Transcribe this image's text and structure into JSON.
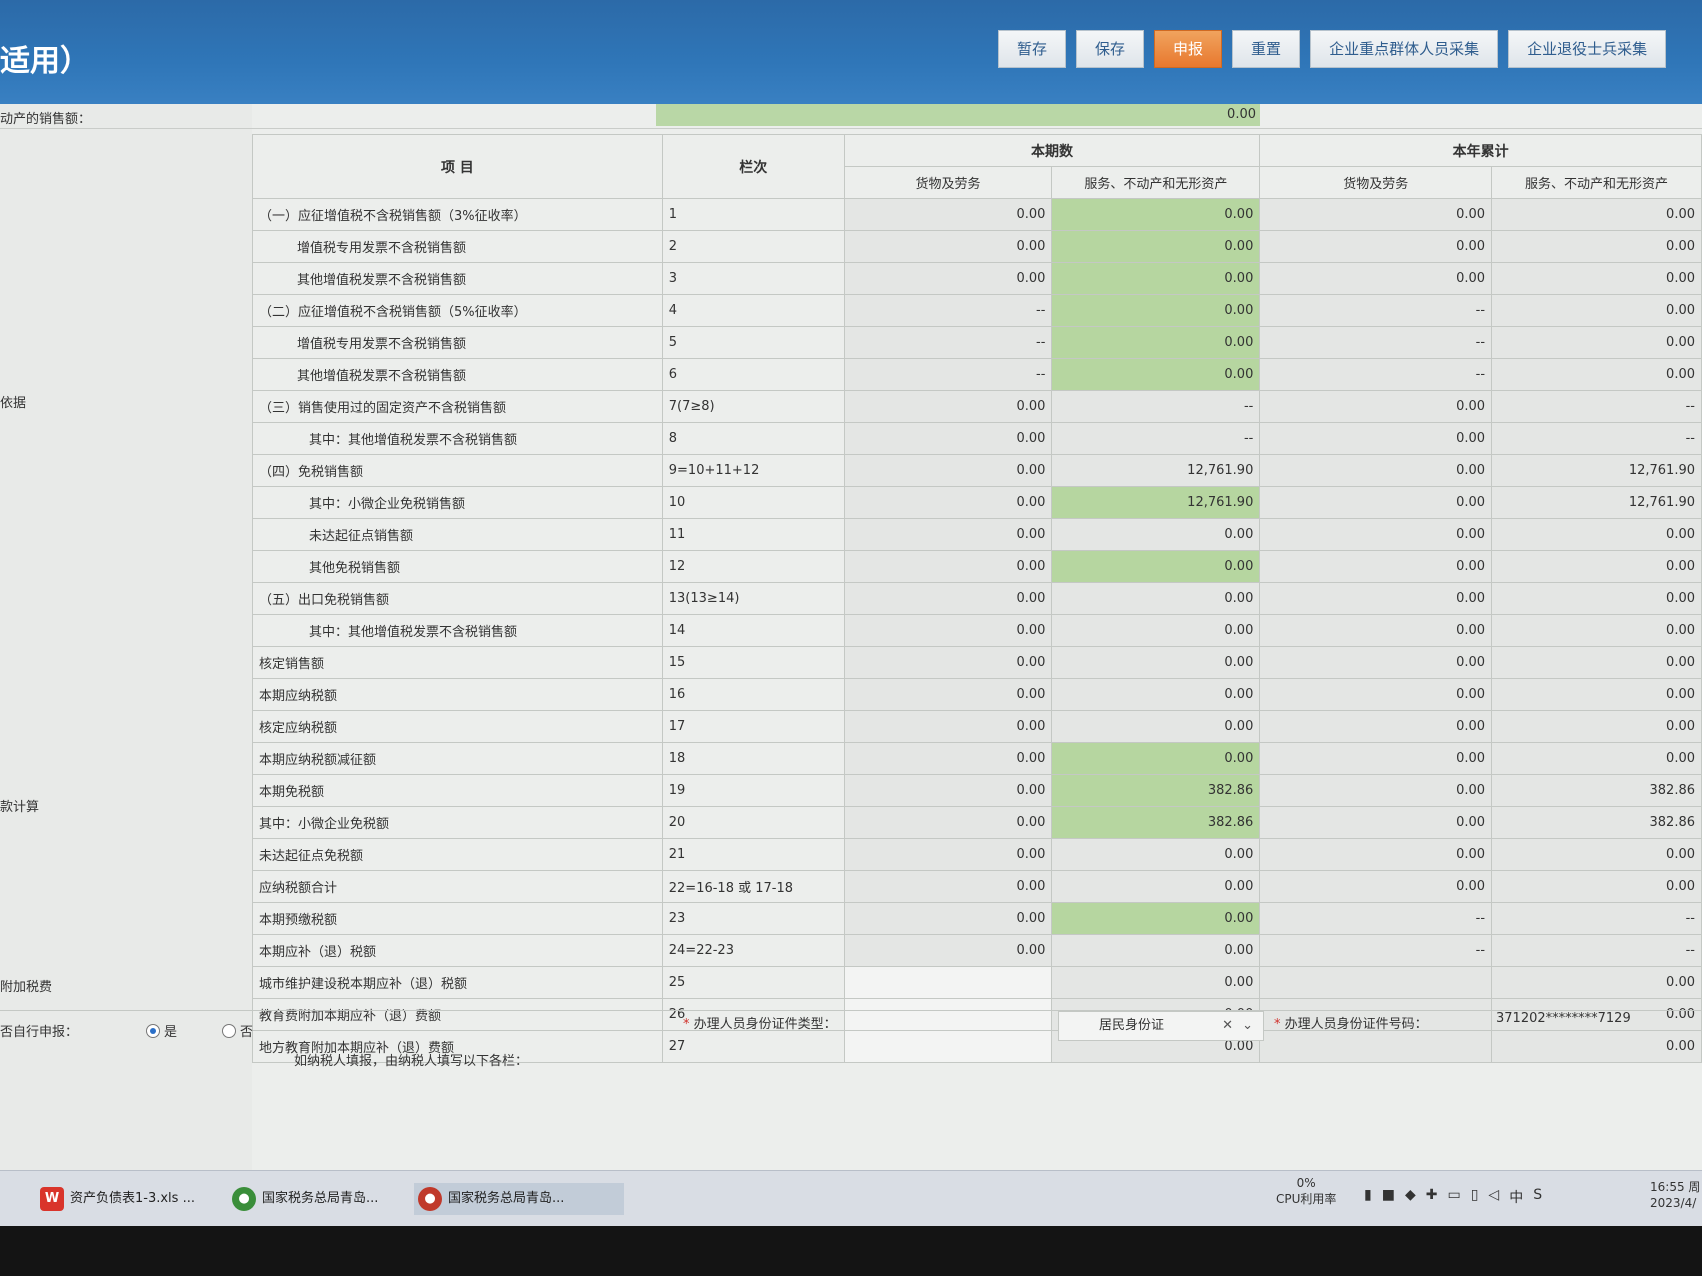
{
  "header": {
    "title": "适用）",
    "buttons": [
      "暂存",
      "保存",
      "申报",
      "重置",
      "企业重点群体人员采集",
      "企业退役士兵采集"
    ]
  },
  "sheet": {
    "top_label": "动产的销售额：",
    "top_value": "0.00",
    "side_labels": [
      "依据",
      "款计算",
      "附加税费"
    ],
    "headers": {
      "item": "项  目",
      "col": "栏次",
      "current": "本期数",
      "ytd": "本年累计",
      "goods": "货物及劳务",
      "services": "服务、不动产和无形资产"
    },
    "rows": [
      {
        "name": "（一）应征增值税不含税销售额（3%征收率）",
        "col": "1",
        "c1": "0.00",
        "c2": "0.00",
        "y1": "0.00",
        "y2": "0.00"
      },
      {
        "name": "增值税专用发票不含税销售额",
        "col": "2",
        "c1": "0.00",
        "c2": "0.00",
        "y1": "0.00",
        "y2": "0.00"
      },
      {
        "name": "其他增值税发票不含税销售额",
        "col": "3",
        "c1": "0.00",
        "c2": "0.00",
        "y1": "0.00",
        "y2": "0.00"
      },
      {
        "name": "（二）应征增值税不含税销售额（5%征收率）",
        "col": "4",
        "c1": "--",
        "c2": "0.00",
        "y1": "--",
        "y2": "0.00"
      },
      {
        "name": "增值税专用发票不含税销售额",
        "col": "5",
        "c1": "--",
        "c2": "0.00",
        "y1": "--",
        "y2": "0.00"
      },
      {
        "name": "其他增值税发票不含税销售额",
        "col": "6",
        "c1": "--",
        "c2": "0.00",
        "y1": "--",
        "y2": "0.00"
      },
      {
        "name": "（三）销售使用过的固定资产不含税销售额",
        "col": "7(7≥8)",
        "c1": "0.00",
        "c2": "--",
        "y1": "0.00",
        "y2": "--"
      },
      {
        "name": "其中：其他增值税发票不含税销售额",
        "col": "8",
        "c1": "0.00",
        "c2": "--",
        "y1": "0.00",
        "y2": "--"
      },
      {
        "name": "（四）免税销售额",
        "col": "9=10+11+12",
        "c1": "0.00",
        "c2": "12,761.90",
        "y1": "0.00",
        "y2": "12,761.90"
      },
      {
        "name": "其中：小微企业免税销售额",
        "col": "10",
        "c1": "0.00",
        "c2": "12,761.90",
        "y1": "0.00",
        "y2": "12,761.90"
      },
      {
        "name": "未达起征点销售额",
        "col": "11",
        "c1": "0.00",
        "c2": "0.00",
        "y1": "0.00",
        "y2": "0.00"
      },
      {
        "name": "其他免税销售额",
        "col": "12",
        "c1": "0.00",
        "c2": "0.00",
        "y1": "0.00",
        "y2": "0.00"
      },
      {
        "name": "（五）出口免税销售额",
        "col": "13(13≥14)",
        "c1": "0.00",
        "c2": "0.00",
        "y1": "0.00",
        "y2": "0.00"
      },
      {
        "name": "其中：其他增值税发票不含税销售额",
        "col": "14",
        "c1": "0.00",
        "c2": "0.00",
        "y1": "0.00",
        "y2": "0.00"
      },
      {
        "name": "核定销售额",
        "col": "15",
        "c1": "0.00",
        "c2": "0.00",
        "y1": "0.00",
        "y2": "0.00"
      },
      {
        "name": "本期应纳税额",
        "col": "16",
        "c1": "0.00",
        "c2": "0.00",
        "y1": "0.00",
        "y2": "0.00"
      },
      {
        "name": "核定应纳税额",
        "col": "17",
        "c1": "0.00",
        "c2": "0.00",
        "y1": "0.00",
        "y2": "0.00"
      },
      {
        "name": "本期应纳税额减征额",
        "col": "18",
        "c1": "0.00",
        "c2": "0.00",
        "y1": "0.00",
        "y2": "0.00"
      },
      {
        "name": "本期免税额",
        "col": "19",
        "c1": "0.00",
        "c2": "382.86",
        "y1": "0.00",
        "y2": "382.86"
      },
      {
        "name": "其中：小微企业免税额",
        "col": "20",
        "c1": "0.00",
        "c2": "382.86",
        "y1": "0.00",
        "y2": "382.86"
      },
      {
        "name": "未达起征点免税额",
        "col": "21",
        "c1": "0.00",
        "c2": "0.00",
        "y1": "0.00",
        "y2": "0.00"
      },
      {
        "name": "应纳税额合计",
        "col": "22=16-18 或 17-18",
        "c1": "0.00",
        "c2": "0.00",
        "y1": "0.00",
        "y2": "0.00"
      },
      {
        "name": "本期预缴税额",
        "col": "23",
        "c1": "0.00",
        "c2": "0.00",
        "y1": "--",
        "y2": "--"
      },
      {
        "name": "本期应补（退）税额",
        "col": "24=22-23",
        "c1": "0.00",
        "c2": "0.00",
        "y1": "--",
        "y2": "--"
      },
      {
        "name": "城市维护建设税本期应补（退）税额",
        "col": "25",
        "c1": "",
        "c2": "0.00",
        "y1": "",
        "y2": "0.00"
      },
      {
        "name": "教育费附加本期应补（退）费额",
        "col": "26",
        "c1": "",
        "c2": "0.00",
        "y1": "",
        "y2": "0.00"
      },
      {
        "name": "地方教育附加本期应补（退）费额",
        "col": "27",
        "c1": "",
        "c2": "0.00",
        "y1": "",
        "y2": "0.00"
      }
    ]
  },
  "footer": {
    "self_declare_label": "否自行申报：",
    "opt_yes": "是",
    "opt_no": "否",
    "id_type_label": "办理人员身份证件类型：",
    "id_type_value": "居民身份证",
    "id_no_label": "办理人员身份证件号码：",
    "id_no_value": "371202********7129",
    "note": "如纳税人填报，由纳税人填写以下各栏："
  },
  "taskbar": {
    "items": [
      "资产负债表1-3.xls ...",
      "国家税务总局青岛...",
      "国家税务总局青岛..."
    ],
    "cpu_value": "0%",
    "cpu_label": "CPU利用率",
    "ime": "中",
    "time": "16:55 周",
    "date": "2023/4/"
  }
}
